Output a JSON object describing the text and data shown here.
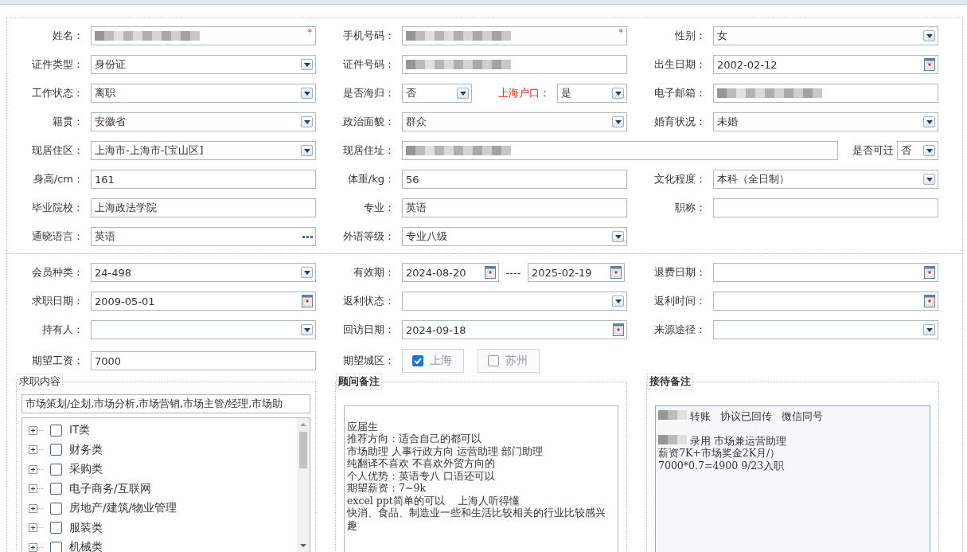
{
  "personal": {
    "fields": [
      {
        "label": "姓名：",
        "kind": "text",
        "redacted": true,
        "mark": "*"
      },
      {
        "label": "手机号码：",
        "kind": "text",
        "redacted": true,
        "mark": "*"
      },
      {
        "label": "性别：",
        "kind": "select",
        "value": "女"
      },
      {
        "label": "证件类型：",
        "kind": "select",
        "value": "身份证"
      },
      {
        "label": "证件号码：",
        "kind": "text",
        "redacted": true
      },
      {
        "label": "出生日期：",
        "kind": "date",
        "value": "2002-02-12"
      },
      {
        "label": "工作状态：",
        "kind": "select",
        "value": "离职"
      },
      {
        "label": "是否海归：",
        "kind": "pair",
        "value": "否",
        "second": {
          "label": "上海户口：",
          "value": "是",
          "emphasis": true
        }
      },
      {
        "label": "电子邮箱：",
        "kind": "text",
        "redacted": true
      },
      {
        "label": "籍贯：",
        "kind": "select",
        "value": "安徽省"
      },
      {
        "label": "政治面貌：",
        "kind": "select",
        "value": "群众"
      },
      {
        "label": "婚育状况：",
        "kind": "select",
        "value": "未婚"
      },
      {
        "label": "现居住区：",
        "kind": "select",
        "value": "上海市-上海市-[宝山区]"
      },
      {
        "label": "现居住址：",
        "kind": "wide",
        "redacted": true,
        "second": {
          "label": "是否可迁",
          "value": "否",
          "emphasis": false
        }
      },
      {
        "label": "身高/cm：",
        "kind": "text",
        "value": "161"
      },
      {
        "label": "体重/kg：",
        "kind": "text",
        "value": "56"
      },
      {
        "label": "文化程度：",
        "kind": "select",
        "value": "本科（全日制）"
      },
      {
        "label": "毕业院校：",
        "kind": "text",
        "value": "上海政法学院"
      },
      {
        "label": "专业：",
        "kind": "text",
        "value": "英语"
      },
      {
        "label": "职称：",
        "kind": "text"
      },
      {
        "label": "通晓语言：",
        "kind": "lookup",
        "value": "英语"
      },
      {
        "label": "外语等级：",
        "kind": "select",
        "value": "专业八级"
      }
    ]
  },
  "membership": {
    "fields": [
      {
        "label": "会员种类：",
        "kind": "select",
        "value": "24-498"
      },
      {
        "label": "有效期：",
        "kind": "range",
        "value": "2024-08-20",
        "separator": "----",
        "value_2": "2025-02-19"
      },
      {
        "label": "退费日期：",
        "kind": "date"
      },
      {
        "label": "求职日期：",
        "kind": "date",
        "value": "2009-05-01"
      },
      {
        "label": "返利状态：",
        "kind": "select"
      },
      {
        "label": "返利时间：",
        "kind": "date"
      },
      {
        "label": "持有人：",
        "kind": "select"
      },
      {
        "label": "回访日期：",
        "kind": "date",
        "value": "2024-09-18"
      },
      {
        "label": "来源途径：",
        "kind": "select"
      },
      {
        "label": "期望工资：",
        "kind": "text",
        "value": "7000"
      },
      {
        "label": "期望城区：",
        "kind": "choices",
        "options": [
          {
            "label": "上海",
            "checked": true
          },
          {
            "label": "苏州",
            "checked": false
          }
        ]
      }
    ]
  },
  "panels": [
    {
      "kind": "tree",
      "title": "求职内容",
      "summary": "市场策划/企划,市场分析,市场营销,市场主管/经理,市场助",
      "tree": [
        {
          "label": "IT类",
          "checked": false,
          "expanded": false
        },
        {
          "label": "财务类",
          "checked": false,
          "expanded": false
        },
        {
          "label": "采购类",
          "checked": false,
          "expanded": false
        },
        {
          "label": "电子商务/互联网",
          "checked": false,
          "expanded": false
        },
        {
          "label": "房地产/建筑/物业管理",
          "checked": false,
          "expanded": false
        },
        {
          "label": "服装类",
          "checked": false,
          "expanded": false
        },
        {
          "label": "机械类",
          "checked": false,
          "expanded": false
        }
      ]
    },
    {
      "kind": "notes",
      "title": "顾问备注",
      "lines": [
        {
          "text": "应届生",
          "gap_before": true,
          "redacted": false
        },
        {
          "text": "推荐方向：适合自己的都可以",
          "gap_before": false,
          "redacted": false
        },
        {
          "text": "市场助理 人事行政方向 运营助理 部门助理",
          "gap_before": false,
          "redacted": false
        },
        {
          "text": "纯翻译不喜欢 不喜欢外贸方向的",
          "gap_before": false,
          "redacted": false
        },
        {
          "text": "个人优势：英语专八 口语还可以",
          "gap_before": false,
          "redacted": false
        },
        {
          "text": "期望薪资：7~9k",
          "gap_before": false,
          "redacted": false
        },
        {
          "text": "excel ppt简单的可以    上海人听得懂",
          "gap_before": false,
          "redacted": false
        },
        {
          "text": "快消、食品、制造业一些和生活比较相关的行业比较感兴趣",
          "gap_before": false,
          "redacted": false
        }
      ]
    },
    {
      "kind": "notes",
      "title": "接待备注",
      "lines": [
        {
          "text": "转账   协议已回传   微信同号",
          "gap_before": false,
          "redacted": true
        },
        {
          "text": "录用 市场兼运营助理",
          "gap_before": true,
          "redacted": true
        },
        {
          "text": "薪资7K+市场奖金2K月/）",
          "gap_before": false,
          "redacted": false
        },
        {
          "text": "7000*0.7=4900 9/23入职",
          "gap_before": false,
          "redacted": false
        }
      ]
    }
  ]
}
